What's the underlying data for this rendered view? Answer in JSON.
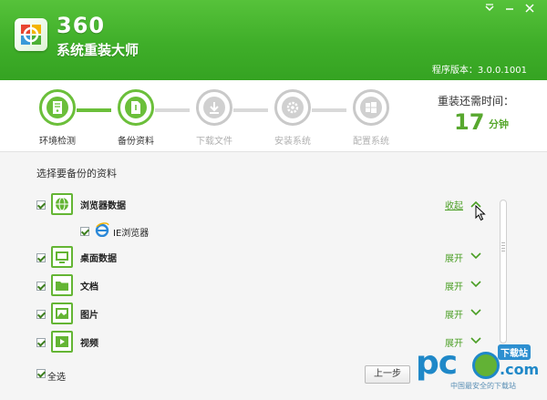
{
  "app": {
    "logo_number": "360",
    "logo_name": "系统重装大师",
    "version": "程序版本：3.0.0.1001"
  },
  "window_controls": [
    "menu-icon",
    "minimize-icon",
    "close-icon"
  ],
  "steps": [
    {
      "label": "环境检测",
      "state": "done",
      "icon": "server-icon"
    },
    {
      "label": "备份资料",
      "state": "done",
      "icon": "file-backup-icon"
    },
    {
      "label": "下载文件",
      "state": "pending",
      "icon": "download-icon"
    },
    {
      "label": "安装系统",
      "state": "pending",
      "icon": "install-gear-icon"
    },
    {
      "label": "配置系统",
      "state": "pending",
      "icon": "windows-config-icon"
    }
  ],
  "timer": {
    "label": "重装还需时间：",
    "value": "17",
    "unit": "分钟"
  },
  "backup": {
    "title": "选择要备份的资料",
    "items": [
      {
        "label": "浏览器数据",
        "checked": true,
        "action": "收起",
        "expanded": true,
        "icon": "globe-icon",
        "children": [
          {
            "label": "IE浏览器",
            "checked": true,
            "icon": "ie-icon"
          }
        ]
      },
      {
        "label": "桌面数据",
        "checked": true,
        "action": "展开",
        "expanded": false,
        "icon": "desktop-icon"
      },
      {
        "label": "文档",
        "checked": true,
        "action": "展开",
        "expanded": false,
        "icon": "folder-icon"
      },
      {
        "label": "图片",
        "checked": true,
        "action": "展开",
        "expanded": false,
        "icon": "picture-icon"
      },
      {
        "label": "视频",
        "checked": true,
        "action": "展开",
        "expanded": false,
        "icon": "video-icon"
      }
    ],
    "select_all": {
      "label": "全选",
      "checked": true
    },
    "prev_button": "上一步"
  },
  "watermark": {
    "brand_pc": "pc",
    "brand_com": ".com",
    "badge": "下载站",
    "subtitle": "中国最安全的下载站"
  },
  "colors": {
    "header_green": "#3fae29",
    "accent_green": "#6bbf3a",
    "timer_green": "#58a82f",
    "watermark_blue": "#1f88c8"
  }
}
